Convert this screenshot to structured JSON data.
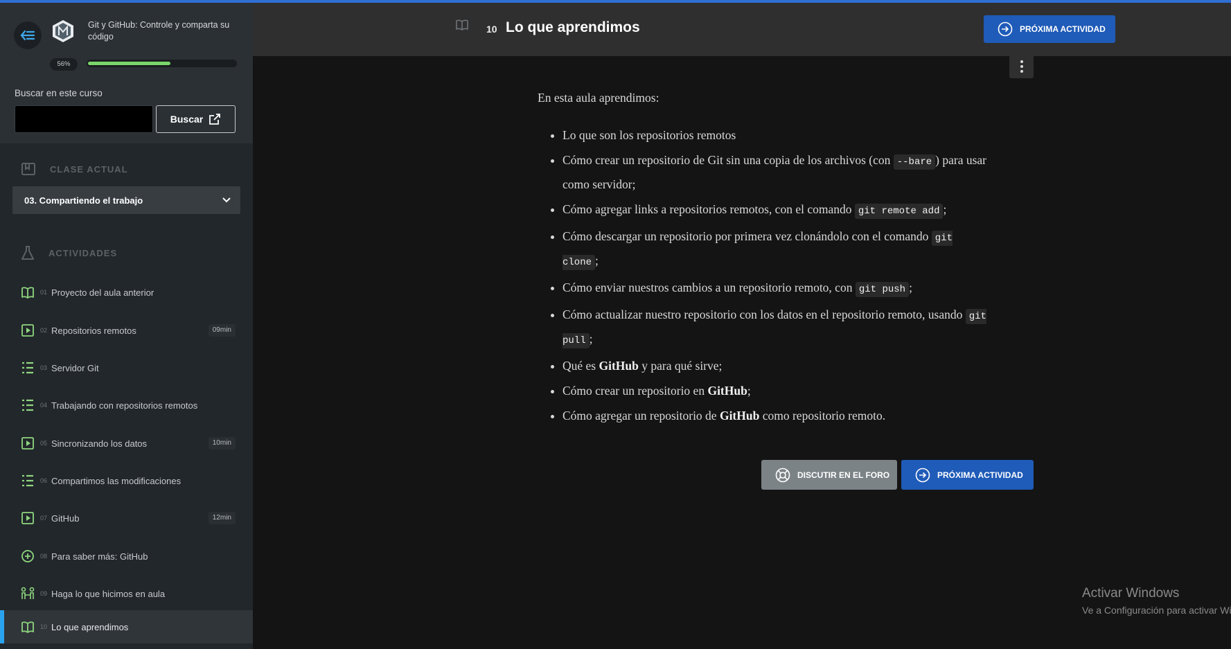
{
  "course": {
    "title": "Git y GitHub: Controle y comparta su código",
    "progress_label": "56%",
    "progress": 0.56
  },
  "search": {
    "label": "Buscar en este curso",
    "placeholder": "",
    "button_label": "Buscar"
  },
  "current_class": {
    "heading": "CLASE ACTUAL",
    "selected": "03. Compartiendo el trabajo"
  },
  "activities": {
    "heading": "ACTIVIDADES",
    "items": [
      {
        "num": "01",
        "label": "Proyecto del aula anterior",
        "icon": "book-open-icon",
        "duration": ""
      },
      {
        "num": "02",
        "label": "Repositorios remotos",
        "icon": "video-icon",
        "duration": "09min"
      },
      {
        "num": "03",
        "label": "Servidor Git",
        "icon": "list-icon",
        "duration": ""
      },
      {
        "num": "04",
        "label": "Trabajando con repositorios remotos",
        "icon": "list-icon",
        "duration": ""
      },
      {
        "num": "05",
        "label": "Sincronizando los datos",
        "icon": "video-icon",
        "duration": "10min"
      },
      {
        "num": "06",
        "label": "Compartimos las modificaciones",
        "icon": "list-icon",
        "duration": ""
      },
      {
        "num": "07",
        "label": "GitHub",
        "icon": "video-icon",
        "duration": "12min"
      },
      {
        "num": "08",
        "label": "Para saber más: GitHub",
        "icon": "plus-circle-icon",
        "duration": ""
      },
      {
        "num": "09",
        "label": "Haga lo que hicimos en aula",
        "icon": "practice-icon",
        "duration": ""
      },
      {
        "num": "10",
        "label": "Lo que aprendimos",
        "icon": "book-open-icon",
        "duration": "",
        "active": true
      }
    ]
  },
  "header": {
    "lesson_number": "10",
    "lesson_title": "Lo que aprendimos",
    "next_button": "PRÓXIMA ACTIVIDAD"
  },
  "content": {
    "intro": "En esta aula aprendimos:",
    "items": {
      "i1": "Lo que son los repositorios remotos",
      "i2_a": "Cómo crear un repositorio de Git sin una copia de los archivos (con ",
      "i2_code": "--bare",
      "i2_b": ") para usar como servidor;",
      "i3_a": "Cómo agregar links a repositorios remotos, con el comando ",
      "i3_code": "git remote add",
      "i3_b": ";",
      "i4_a": "Cómo descargar un repositorio por primera vez clonándolo con el comando ",
      "i4_code": "git clone",
      "i4_b": ";",
      "i5_a": "Cómo enviar nuestros cambios a un repositorio remoto, con ",
      "i5_code": "git push",
      "i5_b": ";",
      "i6_a": "Cómo actualizar nuestro repositorio con los datos en el repositorio remoto, usando ",
      "i6_code": "git pull",
      "i6_b": ";",
      "i7_a": "Qué es ",
      "i7_b": "GitHub",
      "i7_c": " y para qué sirve;",
      "i8_a": "Cómo crear un repositorio en ",
      "i8_b": "GitHub",
      "i8_c": ";",
      "i9_a": "Cómo agregar un repositorio de ",
      "i9_b": "GitHub",
      "i9_c": " como repositorio remoto."
    }
  },
  "footer_buttons": {
    "forum": "DISCUTIR EN EL FORO",
    "next": "PRÓXIMA ACTIVIDAD"
  },
  "watermark": {
    "title": "Activar Windows",
    "subtitle": "Ve a Configuración para activar Windows."
  },
  "colors": {
    "accent_blue": "#1f5bb8",
    "progress_green": "#7bd56b",
    "icon_green": "#8fd77f",
    "active_marker": "#2aa3ef"
  }
}
